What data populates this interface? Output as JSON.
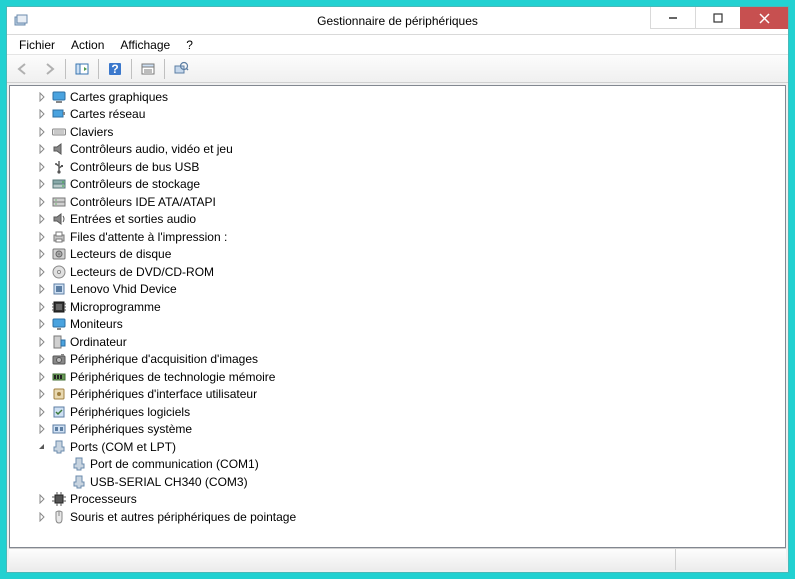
{
  "window": {
    "title": "Gestionnaire de périphériques"
  },
  "menu": {
    "file": "Fichier",
    "action": "Action",
    "view": "Affichage",
    "help": "?"
  },
  "tree": {
    "items": [
      {
        "label": "Cartes graphiques",
        "expanded": false,
        "icon": "display-adapter",
        "depth": 0
      },
      {
        "label": "Cartes réseau",
        "expanded": false,
        "icon": "network-adapter",
        "depth": 0
      },
      {
        "label": "Claviers",
        "expanded": false,
        "icon": "keyboard",
        "depth": 0
      },
      {
        "label": "Contrôleurs audio, vidéo et jeu",
        "expanded": false,
        "icon": "audio-controller",
        "depth": 0
      },
      {
        "label": "Contrôleurs de bus USB",
        "expanded": false,
        "icon": "usb-controller",
        "depth": 0
      },
      {
        "label": "Contrôleurs de stockage",
        "expanded": false,
        "icon": "storage-controller",
        "depth": 0
      },
      {
        "label": "Contrôleurs IDE ATA/ATAPI",
        "expanded": false,
        "icon": "ide-controller",
        "depth": 0
      },
      {
        "label": "Entrées et sorties audio",
        "expanded": false,
        "icon": "audio-io",
        "depth": 0
      },
      {
        "label": "Files d'attente à l'impression :",
        "expanded": false,
        "icon": "print-queue",
        "depth": 0
      },
      {
        "label": "Lecteurs de disque",
        "expanded": false,
        "icon": "disk-drive",
        "depth": 0
      },
      {
        "label": "Lecteurs de DVD/CD-ROM",
        "expanded": false,
        "icon": "optical-drive",
        "depth": 0
      },
      {
        "label": "Lenovo Vhid Device",
        "expanded": false,
        "icon": "device-generic",
        "depth": 0
      },
      {
        "label": "Microprogramme",
        "expanded": false,
        "icon": "firmware",
        "depth": 0
      },
      {
        "label": "Moniteurs",
        "expanded": false,
        "icon": "monitor",
        "depth": 0
      },
      {
        "label": "Ordinateur",
        "expanded": false,
        "icon": "computer",
        "depth": 0
      },
      {
        "label": "Périphérique d'acquisition d'images",
        "expanded": false,
        "icon": "imaging-device",
        "depth": 0
      },
      {
        "label": "Périphériques de technologie mémoire",
        "expanded": false,
        "icon": "memory-tech",
        "depth": 0
      },
      {
        "label": "Périphériques d'interface utilisateur",
        "expanded": false,
        "icon": "hid-device",
        "depth": 0
      },
      {
        "label": "Périphériques logiciels",
        "expanded": false,
        "icon": "software-device",
        "depth": 0
      },
      {
        "label": "Périphériques système",
        "expanded": false,
        "icon": "system-device",
        "depth": 0
      },
      {
        "label": "Ports (COM et LPT)",
        "expanded": true,
        "icon": "port",
        "depth": 0
      },
      {
        "label": "Port de communication (COM1)",
        "expanded": null,
        "icon": "port",
        "depth": 1
      },
      {
        "label": "USB-SERIAL CH340 (COM3)",
        "expanded": null,
        "icon": "port",
        "depth": 1
      },
      {
        "label": "Processeurs",
        "expanded": false,
        "icon": "processor",
        "depth": 0
      },
      {
        "label": "Souris et autres périphériques de pointage",
        "expanded": false,
        "icon": "mouse",
        "depth": 0
      }
    ]
  }
}
